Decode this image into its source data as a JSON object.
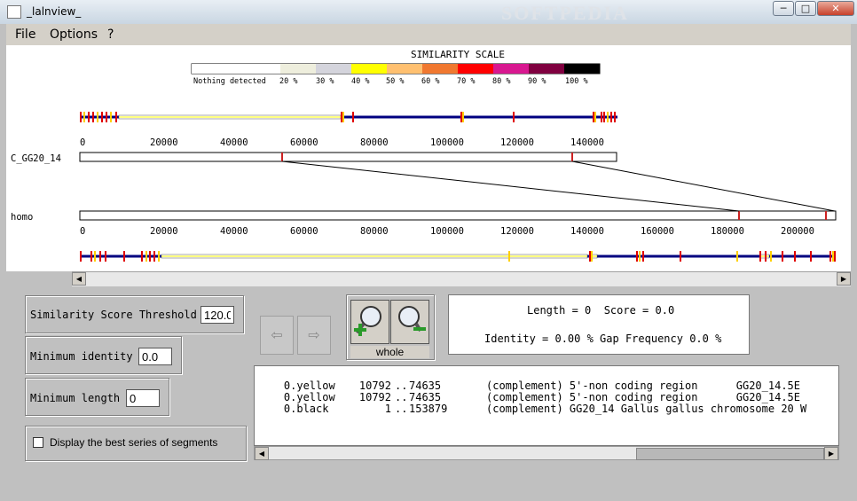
{
  "window": {
    "title": "_lalnview_",
    "min_label": "─",
    "max_label": "□",
    "close_label": "✕",
    "watermark": "SOFTPEDIA"
  },
  "menu": {
    "items": [
      "File",
      "Options",
      "?"
    ]
  },
  "scale": {
    "title": "SIMILARITY SCALE",
    "colors": [
      "#ffffff",
      "#eeeedd",
      "#d4d4dc",
      "#ffff00",
      "#ffc070",
      "#f07830",
      "#ff0000",
      "#d81890",
      "#800040",
      "#000000"
    ],
    "labels": [
      "Nothing detected",
      "20 %",
      "30 %",
      "40 %",
      "50 %",
      "60 %",
      "70 %",
      "80 %",
      "90 %",
      "100 %"
    ]
  },
  "sequences": {
    "top": {
      "name": "C_GG20_14",
      "ticks": [
        "0",
        "20000",
        "40000",
        "60000",
        "80000",
        "100000",
        "120000",
        "140000"
      ]
    },
    "bottom": {
      "name": "homo",
      "ticks": [
        "0",
        "20000",
        "40000",
        "60000",
        "80000",
        "100000",
        "120000",
        "140000",
        "160000",
        "180000",
        "200000"
      ]
    }
  },
  "params": {
    "threshold_label": "Similarity Score Threshold",
    "threshold_value": "120.0",
    "identity_label": "Minimum identity",
    "identity_value": "0.0",
    "length_label": "Minimum length",
    "length_value": "0",
    "best_series_label": "Display the best series of segments"
  },
  "zoom": {
    "whole_label": "whole",
    "back_label": "⇦",
    "forward_label": "⇨"
  },
  "info": {
    "line1": "Length = 0  Score = 0.0",
    "line2": "Identity = 0.00 % Gap Frequency 0.0 %"
  },
  "segments": [
    {
      "color": "0.yellow",
      "start": "10792",
      "end": "74635",
      "desc": "(complement) 5'-non coding region      GG20_14.5E"
    },
    {
      "color": "0.yellow",
      "start": "10792",
      "end": "74635",
      "desc": "(complement) 5'-non coding region      GG20_14.5E"
    },
    {
      "color": "0.black",
      "start": "1",
      "end": "153879",
      "desc": "(complement) GG20_14 Gallus gallus chromosome 20 W"
    }
  ],
  "colors": {
    "track": "#000080",
    "highlight": "#ffff00",
    "mark": "#cc2222",
    "link": "#000000"
  }
}
